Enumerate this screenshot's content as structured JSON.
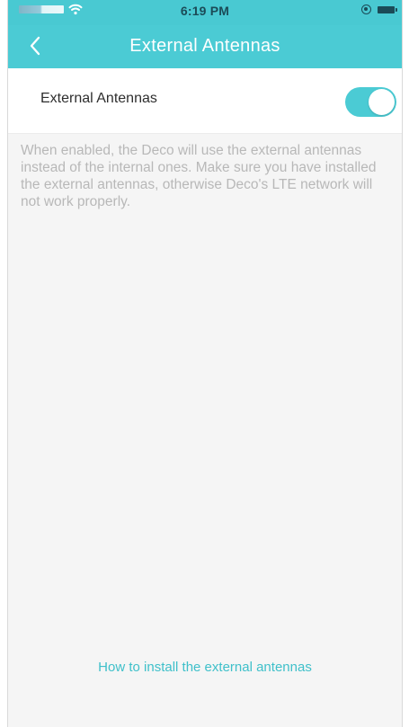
{
  "status_bar": {
    "time": "6:19 PM"
  },
  "nav": {
    "title": "External Antennas",
    "back_icon": "back-chevron-icon"
  },
  "setting": {
    "label": "External Antennas",
    "enabled": true
  },
  "description": "When enabled, the Deco will use the external antennas instead of the internal ones. Make sure you have installed the external antennas, otherwise Deco's LTE network will not work properly.",
  "footer_link": "How to install the external antennas",
  "colors": {
    "accent": "#4bcbd4",
    "background": "#f5f5f5",
    "text": "#2e2e2e",
    "muted_text": "#b8b8b8",
    "link": "#3fc0ca"
  }
}
